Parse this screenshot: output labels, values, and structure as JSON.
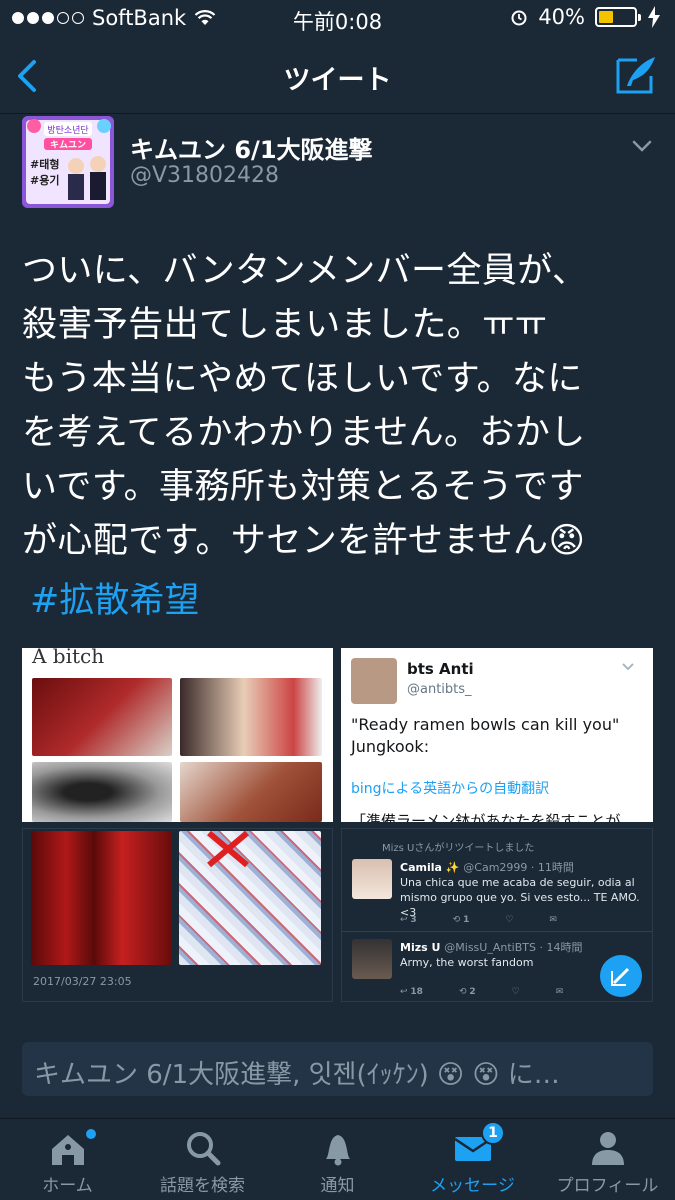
{
  "status_bar": {
    "carrier": "SoftBank",
    "time": "午前0:08",
    "battery": "40%",
    "battery_level": 0.4,
    "signal_bars": 3
  },
  "nav": {
    "title": "ツイート",
    "back_icon": "chevron-left-icon",
    "compose_icon": "compose-tweet-icon"
  },
  "tweet": {
    "author_name": "キムユン 6/1大阪進撃",
    "author_handle": "@V31802428",
    "avatar_text": {
      "line1": "방탄소년단",
      "line2": "キムユン",
      "tag1": "#태형",
      "tag2": "#용기"
    },
    "text_lines": [
      "ついに、バンタンメンバー全員が、",
      "殺害予告出てしまいました。ㅠㅠ",
      "もう本当にやめてほしいです。なに",
      "を考えてるかわかりません。おかし",
      "いです。事務所も対策とるそうです",
      "が心配です。サセンを許せません😡"
    ],
    "hashtag": "#拡散希望"
  },
  "media": {
    "image1": {
      "caption": "A bitch"
    },
    "image2": {
      "name": "bts Anti",
      "handle": "@antibts_",
      "quote_line1": "\"Ready ramen bowls can kill you\"",
      "quote_line2": "Jungkook:",
      "translate": "bingによる英語からの自動翻訳",
      "cut_text": "「準備ラーメン鉢があなたを殺すことが"
    },
    "image3": {
      "date": "2017/03/27 23:05"
    },
    "image4": {
      "retweeted_by": "Mizs Uさんがリツイートしました",
      "tweet1_name": "Camila ✨",
      "tweet1_meta": "@Cam2999 · 11時間",
      "tweet1_text": "Una chica que me acaba de seguir, odia al mismo grupo que yo. Si ves esto... TE AMO. <3",
      "tweet1_counts": [
        "3",
        "1",
        ""
      ],
      "tweet2_name": "Mizs U",
      "tweet2_meta": "@MissU_AntiBTS · 14時間",
      "tweet2_text": "Army, the worst fandom",
      "tweet2_counts": [
        "18",
        "2",
        ""
      ]
    }
  },
  "reply_bar": {
    "text": "キムユン 6/1大阪進撃, 잇젠(ｲｯｹﾝ) 😵 😵 に…"
  },
  "tabs": [
    {
      "label": "ホーム",
      "icon": "home-icon"
    },
    {
      "label": "話題を検索",
      "icon": "search-icon"
    },
    {
      "label": "通知",
      "icon": "bell-icon"
    },
    {
      "label": "メッセージ",
      "icon": "envelope-icon",
      "badge": "1"
    },
    {
      "label": "プロフィール",
      "icon": "profile-icon"
    }
  ],
  "colors": {
    "background": "#1b2836",
    "accent": "#1da1f2",
    "muted": "#8899a6"
  }
}
